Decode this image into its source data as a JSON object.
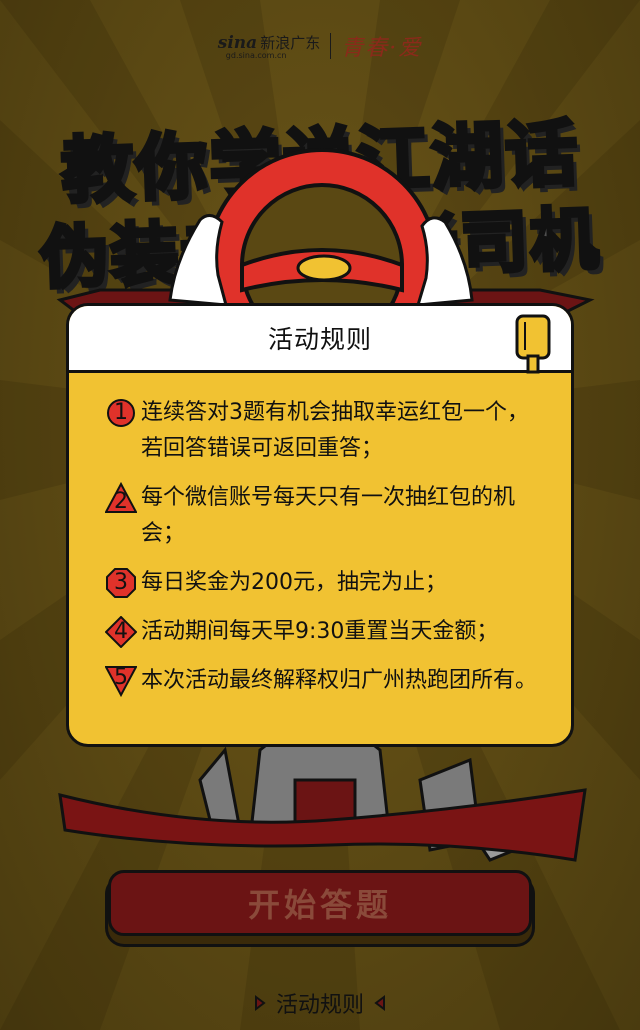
{
  "header": {
    "sina_mark": "sina",
    "sina_name": "新浪广东",
    "sina_url": "gd.sina.com.cn",
    "partner_logo": "青春·爱"
  },
  "title": {
    "line1": "教你学说江湖话",
    "line2": "伪装老江湖老司机"
  },
  "modal": {
    "title": "活动规则",
    "icon": "popsicle-icon",
    "rules": [
      {
        "num": "1",
        "shape": "circle",
        "text": "连续答对3题有机会抽取幸运红包一个，若回答错误可返回重答；"
      },
      {
        "num": "2",
        "shape": "triangle",
        "text": "每个微信账号每天只有一次抽红包的机会；"
      },
      {
        "num": "3",
        "shape": "octagon",
        "text": "每日奖金为200元，抽完为止；"
      },
      {
        "num": "4",
        "shape": "diamond",
        "text": "活动期间每天早9:30重置当天金额；"
      },
      {
        "num": "5",
        "shape": "triangle-down",
        "text": "本次活动最终解释权归广州热跑团所有。"
      }
    ]
  },
  "start_button": {
    "label": "开始答题"
  },
  "rules_link": {
    "label": "活动规则"
  },
  "colors": {
    "background": "#5a4813",
    "modal_body": "#f1c232",
    "badge_red": "#e0322a",
    "button": "#6b1414"
  }
}
